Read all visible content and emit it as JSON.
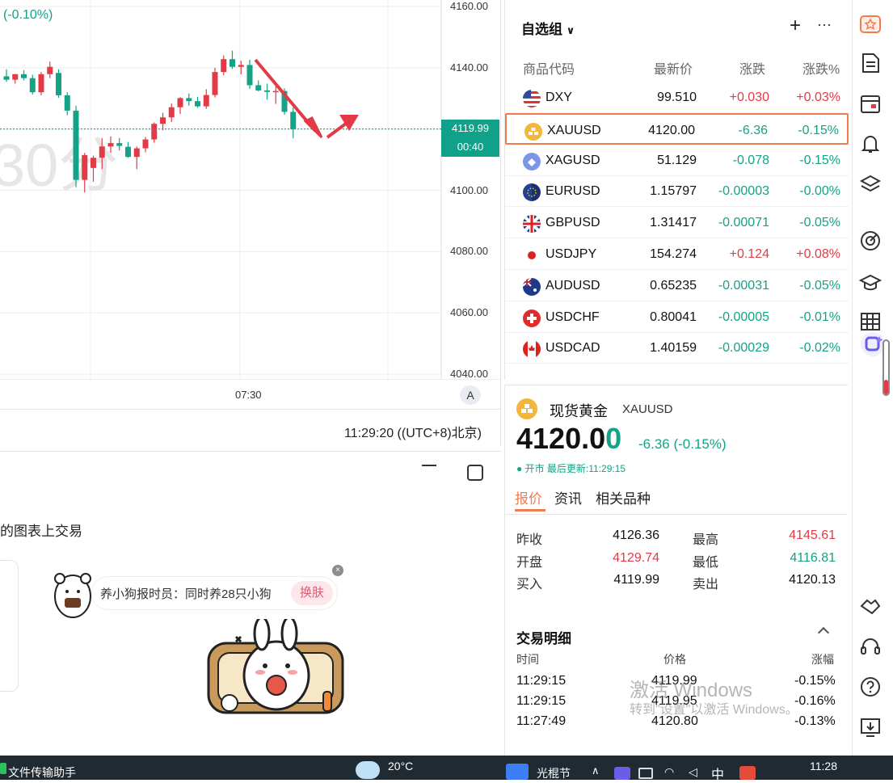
{
  "chart": {
    "change_pct": "(-0.10%)",
    "watermark": "30分",
    "y_ticks": [
      "4160.00",
      "4140.00",
      "4100.00",
      "4080.00",
      "4060.00",
      "4040.00"
    ],
    "current_price": "4119.99",
    "countdown": "00:40",
    "time_tick": "07:30",
    "scale_button": "A",
    "clock": "11:29:20 ((UTC+8)北京)"
  },
  "chart_data": {
    "type": "candlestick",
    "ylim": [
      4040,
      4160
    ],
    "y_ticks": [
      4160,
      4140,
      4100,
      4080,
      4060,
      4040
    ],
    "x_ticks": [
      "07:30"
    ],
    "current_price": 4119.99,
    "candles": [
      {
        "o": 4137.2,
        "h": 4139.5,
        "l": 4135.4,
        "c": 4136.1
      },
      {
        "o": 4136.1,
        "h": 4138.0,
        "l": 4134.8,
        "c": 4137.9
      },
      {
        "o": 4137.9,
        "h": 4139.2,
        "l": 4135.9,
        "c": 4136.6
      },
      {
        "o": 4136.6,
        "h": 4137.7,
        "l": 4131.3,
        "c": 4132.0
      },
      {
        "o": 4132.0,
        "h": 4138.6,
        "l": 4131.0,
        "c": 4137.9
      },
      {
        "o": 4137.9,
        "h": 4142.0,
        "l": 4136.6,
        "c": 4140.3
      },
      {
        "o": 4138.3,
        "h": 4139.5,
        "l": 4130.2,
        "c": 4131.0
      },
      {
        "o": 4131.0,
        "h": 4132.0,
        "l": 4124.5,
        "c": 4126.0
      },
      {
        "o": 4126.0,
        "h": 4127.6,
        "l": 4101.0,
        "c": 4103.4
      },
      {
        "o": 4103.4,
        "h": 4112.2,
        "l": 4099.3,
        "c": 4111.5
      },
      {
        "o": 4107.3,
        "h": 4111.3,
        "l": 4102.8,
        "c": 4110.6
      },
      {
        "o": 4110.6,
        "h": 4117.0,
        "l": 4106.9,
        "c": 4114.3
      },
      {
        "o": 4114.3,
        "h": 4117.6,
        "l": 4112.2,
        "c": 4115.4
      },
      {
        "o": 4115.4,
        "h": 4117.1,
        "l": 4113.0,
        "c": 4114.5
      },
      {
        "o": 4114.2,
        "h": 4115.8,
        "l": 4110.6,
        "c": 4110.9
      },
      {
        "o": 4110.9,
        "h": 4114.3,
        "l": 4106.9,
        "c": 4113.7
      },
      {
        "o": 4113.7,
        "h": 4117.4,
        "l": 4112.4,
        "c": 4116.6
      },
      {
        "o": 4116.6,
        "h": 4122.2,
        "l": 4115.5,
        "c": 4121.7
      },
      {
        "o": 4121.7,
        "h": 4125.3,
        "l": 4119.6,
        "c": 4123.8
      },
      {
        "o": 4123.8,
        "h": 4128.3,
        "l": 4122.3,
        "c": 4127.1
      },
      {
        "o": 4127.1,
        "h": 4130.4,
        "l": 4124.9,
        "c": 4130.1
      },
      {
        "o": 4130.1,
        "h": 4131.6,
        "l": 4127.6,
        "c": 4129.1
      },
      {
        "o": 4129.1,
        "h": 4130.5,
        "l": 4126.9,
        "c": 4127.4
      },
      {
        "o": 4127.4,
        "h": 4133.0,
        "l": 4126.6,
        "c": 4131.1
      },
      {
        "o": 4131.1,
        "h": 4140.0,
        "l": 4130.3,
        "c": 4138.6
      },
      {
        "o": 4138.6,
        "h": 4144.0,
        "l": 4137.6,
        "c": 4142.8
      },
      {
        "o": 4142.8,
        "h": 4145.6,
        "l": 4139.6,
        "c": 4140.3
      },
      {
        "o": 4140.3,
        "h": 4142.3,
        "l": 4137.8,
        "c": 4140.9
      },
      {
        "o": 4140.9,
        "h": 4142.6,
        "l": 4133.1,
        "c": 4134.3
      },
      {
        "o": 4134.3,
        "h": 4135.9,
        "l": 4132.3,
        "c": 4132.6
      },
      {
        "o": 4132.6,
        "h": 4134.8,
        "l": 4129.6,
        "c": 4132.1
      },
      {
        "o": 4132.1,
        "h": 4134.6,
        "l": 4128.2,
        "c": 4132.4
      },
      {
        "o": 4132.4,
        "h": 4133.3,
        "l": 4124.7,
        "c": 4125.6
      },
      {
        "o": 4125.6,
        "h": 4127.0,
        "l": 4117.0,
        "c": 4119.99
      }
    ]
  },
  "watchlist": {
    "title": "自选组",
    "add_label": "+",
    "more_label": "···",
    "headers": {
      "code": "商品代码",
      "price": "最新价",
      "change": "涨跌",
      "change_pct": "涨跌%"
    },
    "rows": [
      {
        "symbol": "DXY",
        "price": "99.510",
        "change": "+0.030",
        "change_pct": "+0.03%",
        "dir": "up",
        "flag": "us"
      },
      {
        "symbol": "XAUUSD",
        "price": "4120.00",
        "change": "-6.36",
        "change_pct": "-0.15%",
        "dir": "down",
        "flag": "gold",
        "selected": true
      },
      {
        "symbol": "XAGUSD",
        "price": "51.129",
        "change": "-0.078",
        "change_pct": "-0.15%",
        "dir": "down",
        "flag": "silver"
      },
      {
        "symbol": "EURUSD",
        "price": "1.15797",
        "change": "-0.00003",
        "change_pct": "-0.00%",
        "dir": "down",
        "flag": "eu"
      },
      {
        "symbol": "GBPUSD",
        "price": "1.31417",
        "change": "-0.00071",
        "change_pct": "-0.05%",
        "dir": "down",
        "flag": "gb"
      },
      {
        "symbol": "USDJPY",
        "price": "154.274",
        "change": "+0.124",
        "change_pct": "+0.08%",
        "dir": "up",
        "flag": "jp"
      },
      {
        "symbol": "AUDUSD",
        "price": "0.65235",
        "change": "-0.00031",
        "change_pct": "-0.05%",
        "dir": "down",
        "flag": "au"
      },
      {
        "symbol": "USDCHF",
        "price": "0.80041",
        "change": "-0.00005",
        "change_pct": "-0.01%",
        "dir": "down",
        "flag": "ch"
      },
      {
        "symbol": "USDCAD",
        "price": "1.40159",
        "change": "-0.00029",
        "change_pct": "-0.02%",
        "dir": "down",
        "flag": "ca"
      }
    ]
  },
  "detail": {
    "name": "现货黄金",
    "symbol": "XAUUSD",
    "price_main": "4120.0",
    "price_last": "0",
    "change": "-6.36 (-0.15%)",
    "status": "● 开市 最后更新:11:29:15",
    "tabs": [
      "报价",
      "资讯",
      "相关品种"
    ],
    "quotes": [
      {
        "label": "昨收",
        "value": "4126.36",
        "label2": "最高",
        "value2": "4145.61",
        "c1": "#111",
        "c2": "#e23b47"
      },
      {
        "label": "开盘",
        "value": "4129.74",
        "label2": "最低",
        "value2": "4116.81",
        "c1": "#e23b47",
        "c2": "#15a286"
      },
      {
        "label": "买入",
        "value": "4119.99",
        "label2": "卖出",
        "value2": "4120.13",
        "c1": "#111",
        "c2": "#111"
      }
    ],
    "trades_title": "交易明细",
    "trade_headers": {
      "time": "时间",
      "price": "价格",
      "pct": "涨幅"
    },
    "trades": [
      {
        "time": "11:29:15",
        "price": "4119.99",
        "pct": "-0.15%"
      },
      {
        "time": "11:29:15",
        "price": "4119.95",
        "pct": "-0.16%"
      },
      {
        "time": "11:27:49",
        "price": "4120.80",
        "pct": "-0.13%"
      }
    ]
  },
  "bottom_panel": {
    "trade_text": "的图表上交易",
    "notice_text": "养小狗报时员：同时养28只小狗",
    "notice_button": "换肤",
    "notice_close": "×"
  },
  "windows_watermark": {
    "line1": "激活 Windows",
    "line2": "转到\"设置\"以激活 Windows。"
  },
  "taskbar": {
    "app": "文件传输助手",
    "weather": "20°C",
    "app2": "光棍节",
    "ime": "中",
    "time": "11:28"
  },
  "colors": {
    "up": "#e23b47",
    "down": "#15a286",
    "accent": "#f07c52"
  }
}
